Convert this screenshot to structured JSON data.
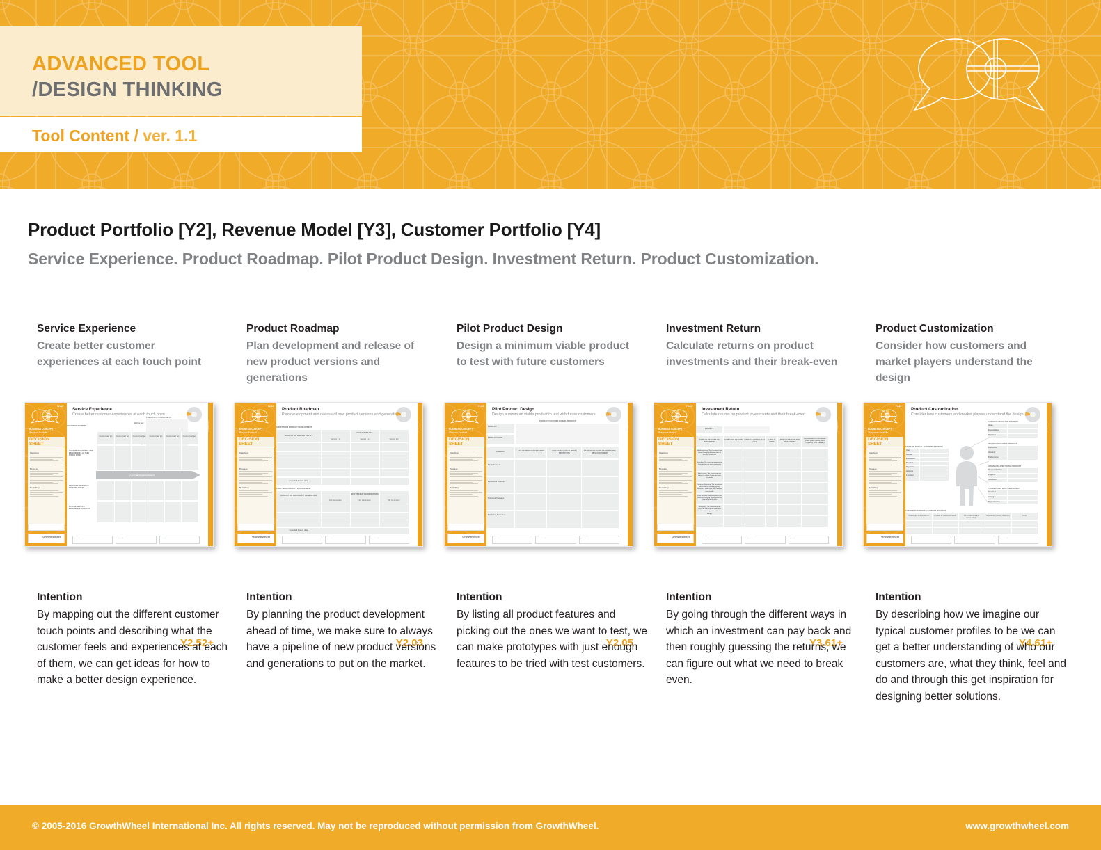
{
  "header": {
    "tool_label": "ADVANCED TOOL",
    "tool_name": "/DESIGN THINKING",
    "content_label": "Tool Content /",
    "version": " ver. 1.1",
    "logo_name": "growthwheel-speech-bubbles-logo",
    "accent_color": "#f0ab28",
    "cream_color": "#faeccc",
    "gray_color": "#6d6e71"
  },
  "page": {
    "title": "Product Portfolio [Y2], Revenue Model [Y3], Customer Portfolio [Y4]",
    "subtitle": "Service Experience. Product Roadmap. Pilot Product Design. Investment Return. Product Customization."
  },
  "intention_heading": "Intention",
  "columns": [
    {
      "name": "Service Experience",
      "description": "Create better customer experiences at each touch point",
      "code": "Y2.52+",
      "intention": "By mapping out the different customer touch points and describing what the customer feels and experiences at each of them, we can get ideas for how to make a better design experience.",
      "sheet": {
        "business_concept_label": "BUSINESS CONCEPT",
        "business_concept_value": "/Product Portfolio",
        "decision_sheet": "DECISION SHEET",
        "title": "Service Experience",
        "subtitle": "Create better customer experiences at each touch point",
        "code": "Y2.52+",
        "side_sections": [
          "Intention",
          "Process",
          "Next Step"
        ],
        "labels": {
          "customer_segment": "CUSTOMER SEGMENT",
          "checklist": "CHECKLIST: TOUCH POINTS",
          "before_buy": "Before buy",
          "during_buy": "During buy",
          "after_buy": "After buy",
          "touch_points": [
            "TOUCH POINT NO.",
            "TOUCH POINT NO.",
            "TOUCH POINT NO.",
            "TOUCH POINT NO.",
            "TOUCH POINT NO.",
            "TOUCH POINT NO."
          ],
          "row1": "CUSTOMER FEELINGS AND EXPERIENCES AT THIS TOUCH POINT",
          "arrow": "CUSTOMER EXPERIENCE",
          "row2": "SERVICE EXPERIENCE OFFERED TODAY",
          "row3": "FUTURE SERVICE EXPERIENCE TO OFFER"
        },
        "footer_fields": [
          "Date",
          "Name",
          "Company"
        ],
        "brand": "GrowthWheel"
      }
    },
    {
      "name": "Product Roadmap",
      "description": "Plan development and release of new product versions and generations",
      "code": "Y2.03",
      "intention": "By planning the product development ahead of time, we make sure to always have a pipeline of new product versions and generations to put on the market.",
      "sheet": {
        "business_concept_label": "BUSINESS CONCEPT",
        "business_concept_value": "/Product Portfolio",
        "decision_sheet": "DECISION SHEET",
        "title": "Product Roadmap",
        "subtitle": "Plan development and release of new product versions and generations",
        "code": "Y2.03",
        "side_sections": [
          "Intention",
          "Process",
          "Next Step"
        ],
        "labels": {
          "short_term": "SHORT TERM PRODUCT DEVELOPMENT",
          "product_col": "PRODUCT OR SERVICE VER. 1.0",
          "new_attributes": "NEW ATTRIBUTES",
          "versions": [
            "Version 1.1",
            "Version 1.2",
            "Version 1.3"
          ],
          "expected_launch": "Expected launch date",
          "long_term": "LONG TERM PRODUCT DEVELOPMENT",
          "product_col2": "PRODUCT OR SERVICE 1ST GENERATION",
          "new_generations": "NEW PRODUCT GENERATIONS",
          "generations": [
            "2nd Generation",
            "3rd Generation",
            "4th Generation"
          ],
          "expected_launch2": "Expected launch date"
        },
        "footer_fields": [
          "Date",
          "Name",
          "Company"
        ],
        "brand": "GrowthWheel"
      }
    },
    {
      "name": "Pilot Product Design",
      "description": "Design a minimum viable product to test with future customers",
      "code": "Y2.05",
      "intention": "By listing all product features and picking out the ones we want to test, we can make prototypes with just enough features to be tried with test customers.",
      "sheet": {
        "business_concept_label": "BUSINESS CONCEPT",
        "business_concept_value": "/Product Portfolio",
        "decision_sheet": "DECISION SHEET",
        "title": "Pilot Product Design",
        "subtitle": "Design a minimum viable product to test with future customers",
        "code": "Y2.05",
        "side_sections": [
          "Intention",
          "Process",
          "Next Step"
        ],
        "labels": {
          "product": "PRODUCT",
          "product_name": "PRODUCT NAME",
          "summary": "SUMMARY",
          "product_features": "PRODUCT FEATURES IN FINAL PRODUCT",
          "list_of_product": "LIST OF PRODUCT FEATURES",
          "how_to_include": "HOW TO INCLUDE IN PILOT / PROTOTYPE",
          "what_to_test": "WHAT TO MEASURE WHEN TESTING WITH CUSTOMERS",
          "rows": [
            "Basic Features",
            "Functional Features",
            "Technical Features",
            "Marketing Features"
          ]
        },
        "footer_fields": [
          "Date",
          "Name",
          "Company"
        ],
        "brand": "GrowthWheel"
      }
    },
    {
      "name": "Investment Return",
      "description": "Calculate returns on product investments and their break-even",
      "code": "Y3.61+",
      "intention": "By going through the different ways in which an investment can pay back and then roughly guessing the returns, we can figure out what we need to break even.",
      "sheet": {
        "business_concept_label": "BUSINESS CONCEPT",
        "business_concept_value": "/Revenue Model",
        "decision_sheet": "DECISION SHEET",
        "title": "Investment Return",
        "subtitle": "Calculate returns on product investments and their break-even",
        "code": "Y3.61+",
        "side_sections": [
          "Intention",
          "Process",
          "Next Step"
        ],
        "labels": {
          "project": "PROJECT",
          "cols": [
            "TYPE OF RETURNS OF INVESTMENT",
            "EXPECTED RETURN",
            "AVERAGE PROFIT (% of profit)",
            "LIKELY ODDS",
            "TOTAL COSTS OF THE INVESTMENT",
            "REQUIREMENTS FOR BREAK-EVEN (sales volume, sales frequency, price changes)"
          ],
          "rows": [
            "Additional sales: The investment can return through additional sales to existing customers",
            "Retention: The investment can return through sales to more customers",
            "Market entry: The investment can return by selling to new customer segments",
            "Customer Retention: The investment can return by creating loyalty, customers return and sales revenue from loyalty",
            "Price increase: The investment can return by charging higher prices for products and services",
            "More profit: The investment can return by reducing the costs and therefore creating the contribution margin"
          ]
        },
        "footer_fields": [
          "Date",
          "Name",
          "Company"
        ],
        "brand": "GrowthWheel"
      }
    },
    {
      "name": "Product Customization",
      "description": "Consider how customers and market players understand the design",
      "code": "Y4.61+",
      "intention": "By describing how we imagine our typical customer profiles to be we can get a better understanding of who our customers are, what they think, feel and do and through this get inspiration for designing better solutions.",
      "sheet": {
        "business_concept_label": "BUSINESS CONCEPT",
        "business_concept_value": "/Customer Portfolio",
        "decision_sheet": "DECISION SHEET",
        "title": "Product Customization",
        "subtitle": "Consider how customers and market players understand the design",
        "code": "Y4.61+",
        "side_sections": [
          "Intention",
          "Process",
          "Next Step"
        ],
        "labels": {
          "facts": "FACTS ON TYPICAL CUSTOMER PERSONA",
          "facts_rows": [
            "Age",
            "Gender",
            "Education",
            "Position",
            "Report to",
            "Industry",
            "Location"
          ],
          "thoughts": "THOUGHTS ABOUT THE PRODUCT",
          "thoughts_rows": [
            "Ideas",
            "Expectations",
            "Opinions"
          ],
          "feelings": "FEELINGS ABOUT THE PRODUCT",
          "feelings_rows": [
            "Concerns",
            "Interest",
            "Preferences"
          ],
          "actions": "ACTIONS RELATED TO THE PRODUCT",
          "actions_rows": [
            "Responsibilities",
            "Projects",
            "Activities"
          ],
          "future": "FUTURE PLANS WITH THE PRODUCT",
          "future_rows": [
            "Direction",
            "Changes",
            "Opportunities"
          ],
          "persona_situation": "CUSTOMER PERSONA'S CURRENT SITUATION",
          "situation_cols": [
            "Challenges and problems",
            "Created or welcomed needs",
            "Circumstances and surroundings",
            "Resources (money, time, etc)",
            "Other"
          ]
        },
        "footer_fields": [
          "Date",
          "Name",
          "Company"
        ],
        "brand": "GrowthWheel"
      }
    }
  ],
  "footer": {
    "copyright": "© 2005-2016 GrowthWheel International Inc. All rights reserved. May not be reproduced without permission from GrowthWheel.",
    "website": "www.growthwheel.com"
  }
}
